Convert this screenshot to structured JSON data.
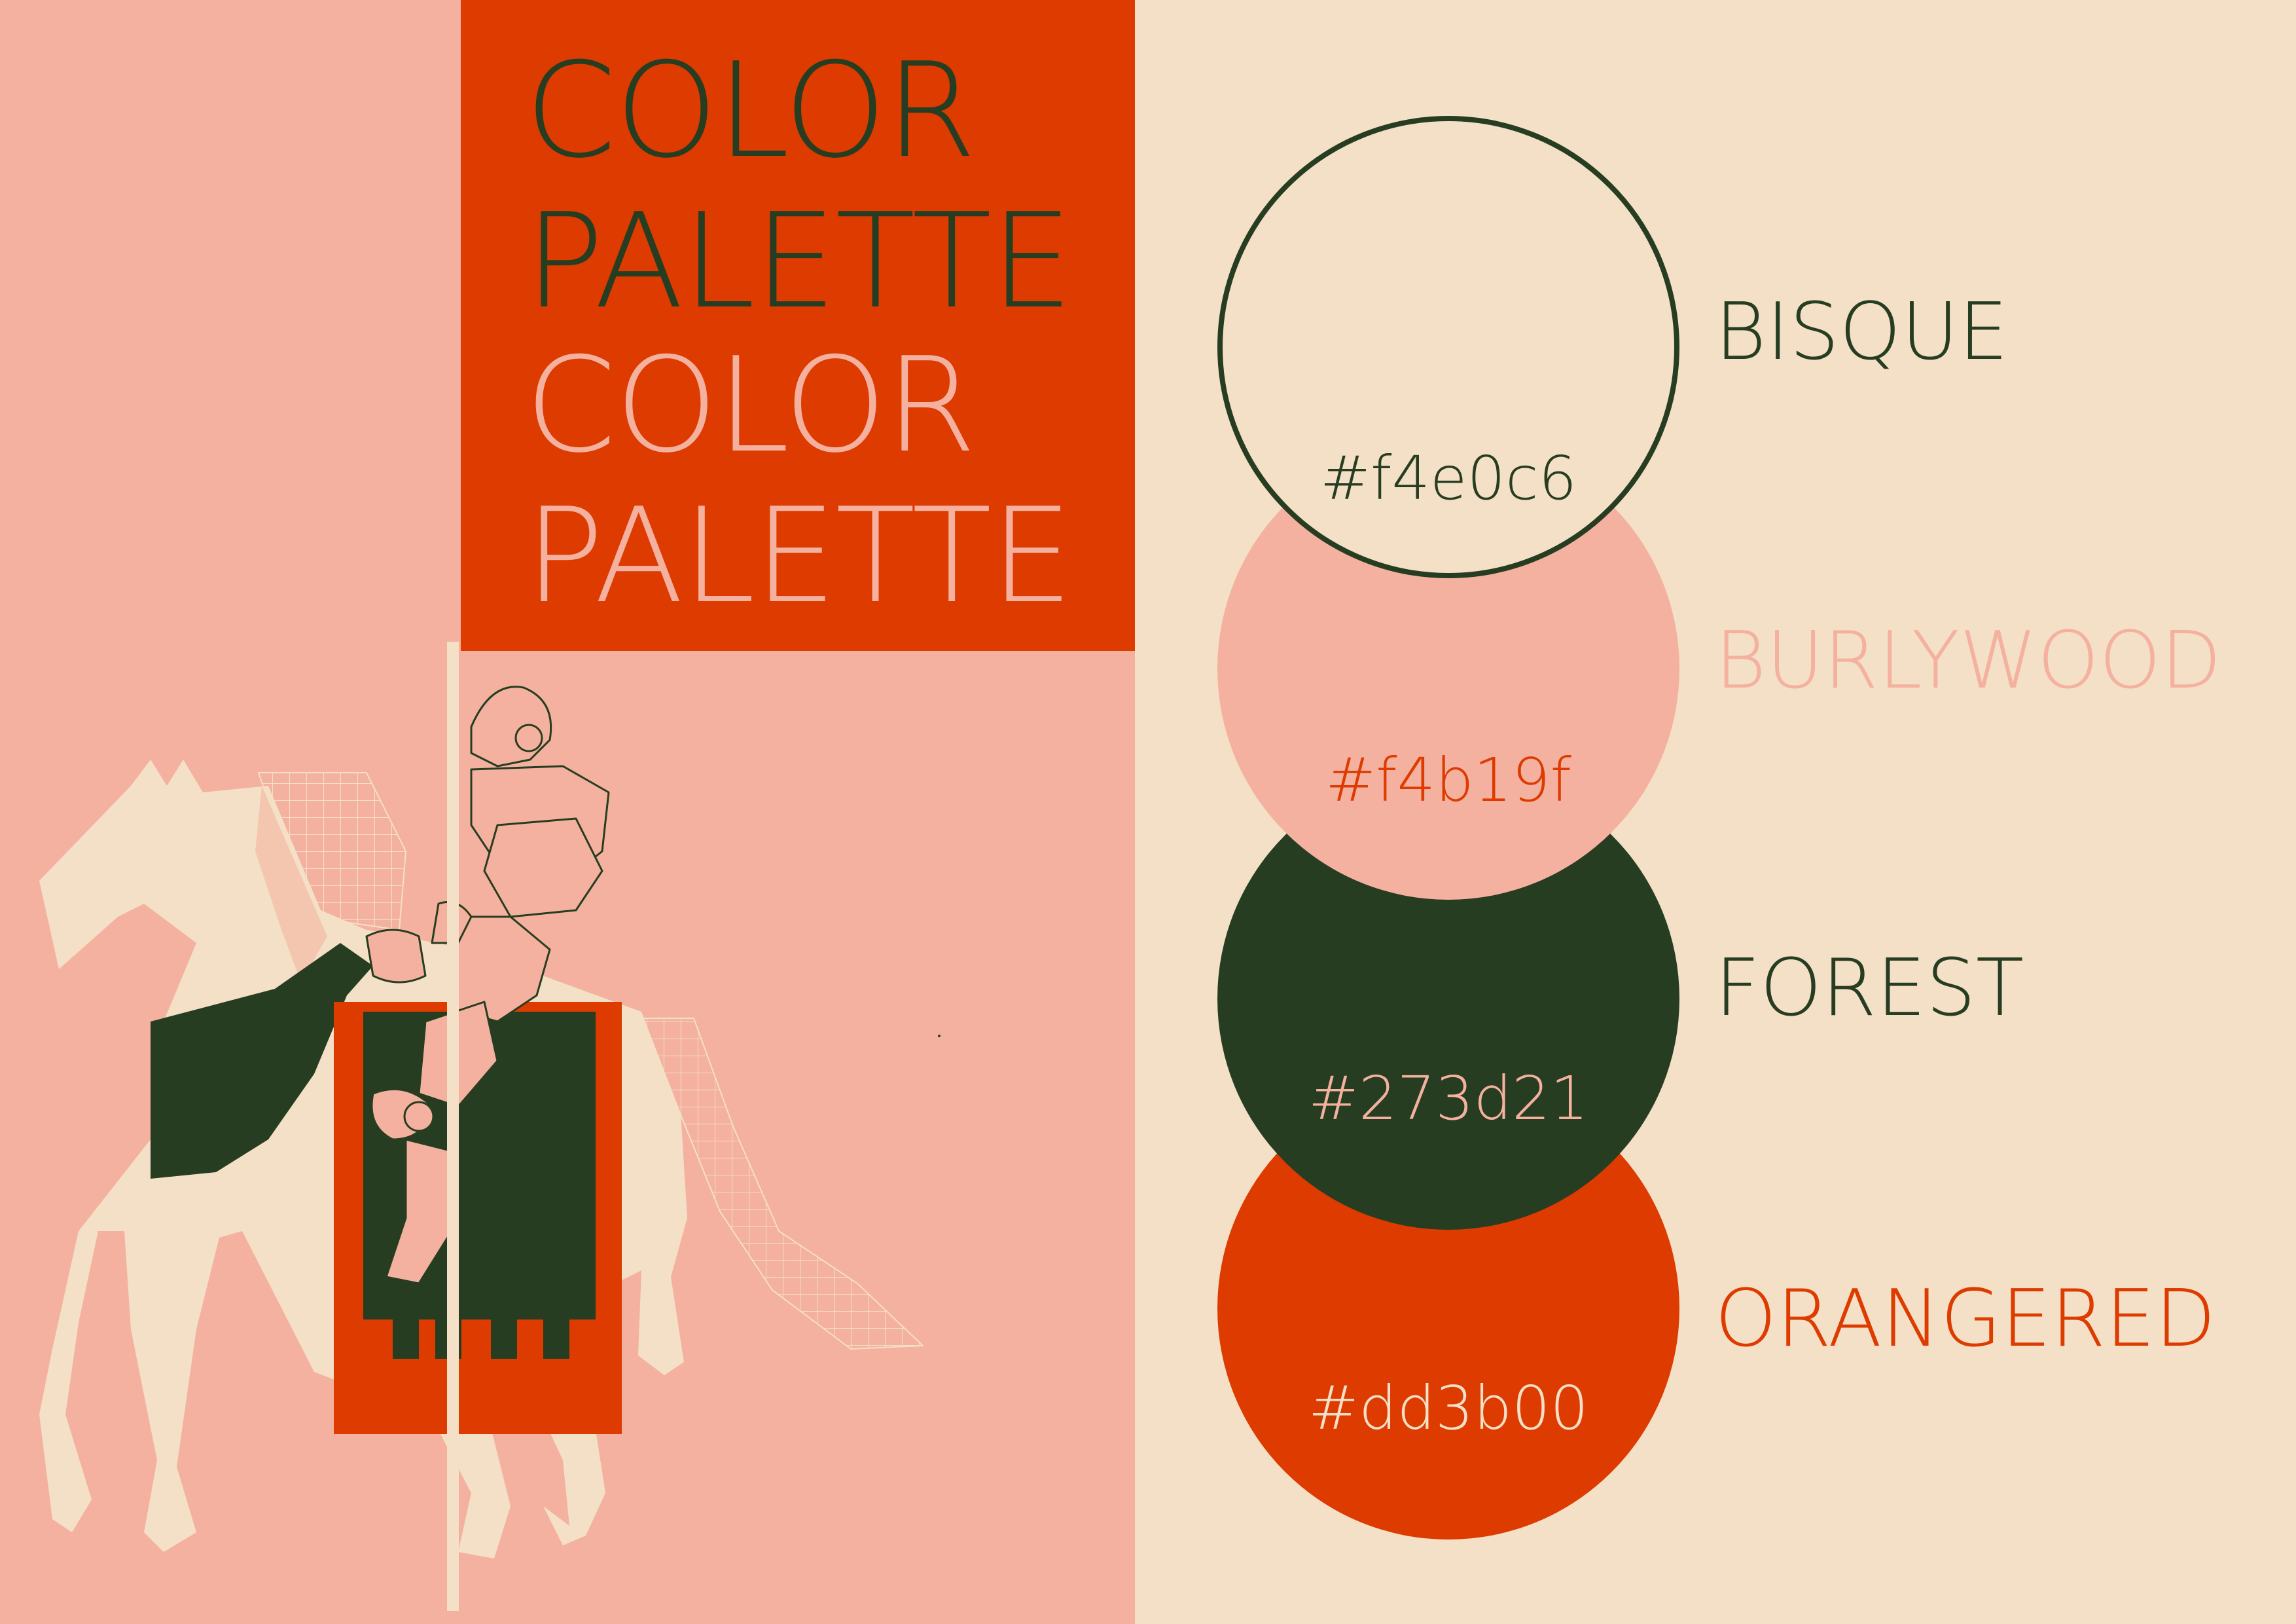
{
  "title": {
    "line1": "COLOR",
    "line2": "PALETTE",
    "line3": "COLOR",
    "line4": "PALETTE"
  },
  "swatches": [
    {
      "name": "BISQUE",
      "hex_label": "#f4e0c6",
      "color": "#f4e0c6"
    },
    {
      "name": "BURLYWOOD",
      "hex_label": "#f4b19f",
      "color": "#f4b19f"
    },
    {
      "name": "FOREST",
      "hex_label": "#273d21",
      "color": "#273d21"
    },
    {
      "name": "ORANGERED",
      "hex_label": "#dd3b00",
      "color": "#dd3b00"
    }
  ],
  "colors": {
    "background_left": "#f4b19f",
    "background_right": "#f4e0c6",
    "title_block": "#dd3b00",
    "outline": "#273d21"
  },
  "illustration": {
    "icon": "knight-on-horse-illustration"
  }
}
